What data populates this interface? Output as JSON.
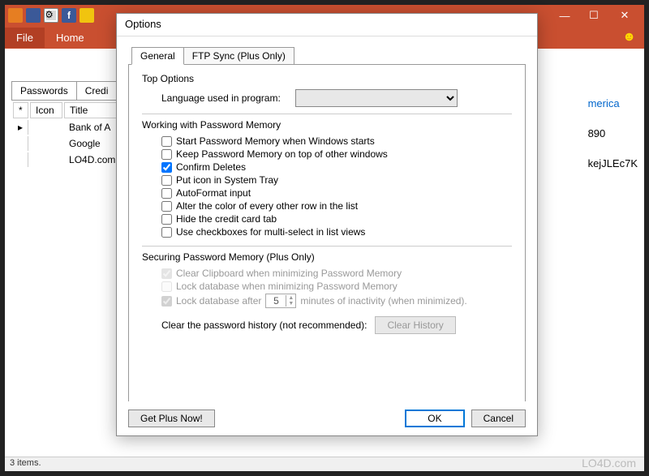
{
  "main_window": {
    "ribbon": {
      "file": "File",
      "home": "Home"
    },
    "tabs": {
      "passwords": "Passwords",
      "credit": "Credi"
    },
    "table": {
      "col_star": "*",
      "col_icon": "Icon",
      "col_title": "Title",
      "rows": [
        "Bank of A",
        "Google",
        "LO4D.com"
      ]
    },
    "right_peek": {
      "link": "merica",
      "num": "890",
      "code": "kejJLEc7K"
    },
    "statusbar": "3 items."
  },
  "options_dialog": {
    "title": "Options",
    "tabs": {
      "general": "General",
      "ftp": "FTP Sync (Plus Only)"
    },
    "top_options": {
      "heading": "Top Options",
      "language_label": "Language used in program:"
    },
    "working": {
      "heading": "Working with Password Memory",
      "cb1": "Start Password Memory when Windows starts",
      "cb2": "Keep Password Memory on top of other windows",
      "cb3": "Confirm Deletes",
      "cb4": "Put icon in System Tray",
      "cb5": "AutoFormat input",
      "cb6": "Alter the color of every other row in the list",
      "cb7": "Hide the credit card tab",
      "cb8": "Use checkboxes for multi-select in list views"
    },
    "securing": {
      "heading": "Securing Password Memory (Plus Only)",
      "cb1": "Clear Clipboard when minimizing Password Memory",
      "cb2": "Lock database when minimizing Password Memory",
      "cb3_pre": "Lock database after",
      "cb3_val": "5",
      "cb3_post": "minutes of inactivity (when minimized).",
      "clear_label": "Clear the password history (not recommended):",
      "clear_btn": "Clear History"
    },
    "footer": {
      "get_plus": "Get Plus Now!",
      "ok": "OK",
      "cancel": "Cancel"
    }
  },
  "watermark": "LO4D.com"
}
